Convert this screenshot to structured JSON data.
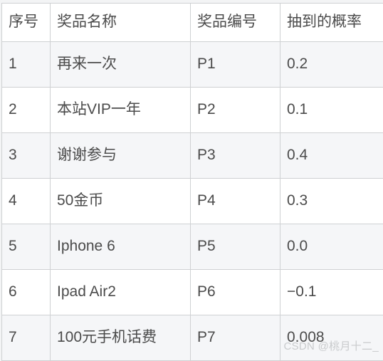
{
  "table": {
    "columns": [
      {
        "key": "index",
        "label": "序号"
      },
      {
        "key": "name",
        "label": "奖品名称"
      },
      {
        "key": "code",
        "label": "奖品编号"
      },
      {
        "key": "prob",
        "label": "抽到的概率"
      }
    ],
    "rows": [
      {
        "index": "1",
        "name": "再来一次",
        "code": "P1",
        "prob": "0.2"
      },
      {
        "index": "2",
        "name": "本站VIP一年",
        "code": "P2",
        "prob": "0.1"
      },
      {
        "index": "3",
        "name": "谢谢参与",
        "code": "P3",
        "prob": "0.4"
      },
      {
        "index": "4",
        "name": "50金币",
        "code": "P4",
        "prob": "0.3"
      },
      {
        "index": "5",
        "name": "Iphone 6",
        "code": "P5",
        "prob": "0.0"
      },
      {
        "index": "6",
        "name": "Ipad Air2",
        "code": "P6",
        "prob": "−0.1"
      },
      {
        "index": "7",
        "name": "100元手机话费",
        "code": "P7",
        "prob": "0.008"
      }
    ]
  },
  "watermark": {
    "text": "CSDN @桃月十二_"
  },
  "colors": {
    "page_background": "#f3f4f5",
    "row_even_background": "#ffffff",
    "row_odd_background": "#f5f6f8",
    "border": "#cfd1d3",
    "text": "#4b4b4b",
    "watermark": "#c9cbcd"
  }
}
